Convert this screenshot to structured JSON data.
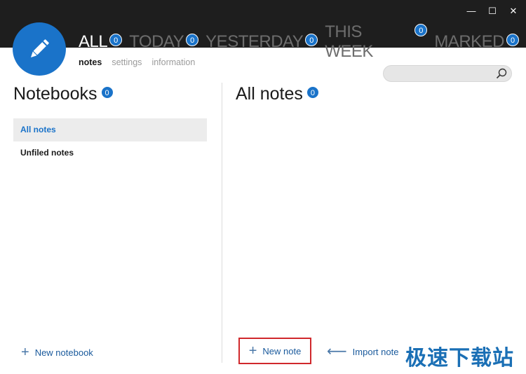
{
  "colors": {
    "accent": "#1a73c9",
    "topbar": "#1e1e1e",
    "highlight_border": "#d0282c"
  },
  "window_controls": {
    "minimize": "—",
    "maximize": "☐",
    "close": "✕"
  },
  "tabs": [
    {
      "label": "ALL",
      "count": "0"
    },
    {
      "label": "TODAY",
      "count": "0"
    },
    {
      "label": "YESTERDAY",
      "count": "0"
    },
    {
      "label": "THIS WEEK",
      "count": "0"
    },
    {
      "label": "MARKED",
      "count": "0"
    }
  ],
  "logo_icon": "pencil-icon",
  "subnav": {
    "notes": "notes",
    "settings": "settings",
    "information": "information"
  },
  "search": {
    "placeholder": "",
    "icon": "search-icon"
  },
  "notebooks": {
    "title": "Notebooks",
    "count": "0",
    "items": [
      {
        "label": "All notes"
      },
      {
        "label": "Unfiled notes"
      }
    ],
    "new_label": "New notebook"
  },
  "notes": {
    "title": "All notes",
    "count": "0",
    "new_label": "New note",
    "import_label": "Import note"
  },
  "watermark": "极速下载站"
}
